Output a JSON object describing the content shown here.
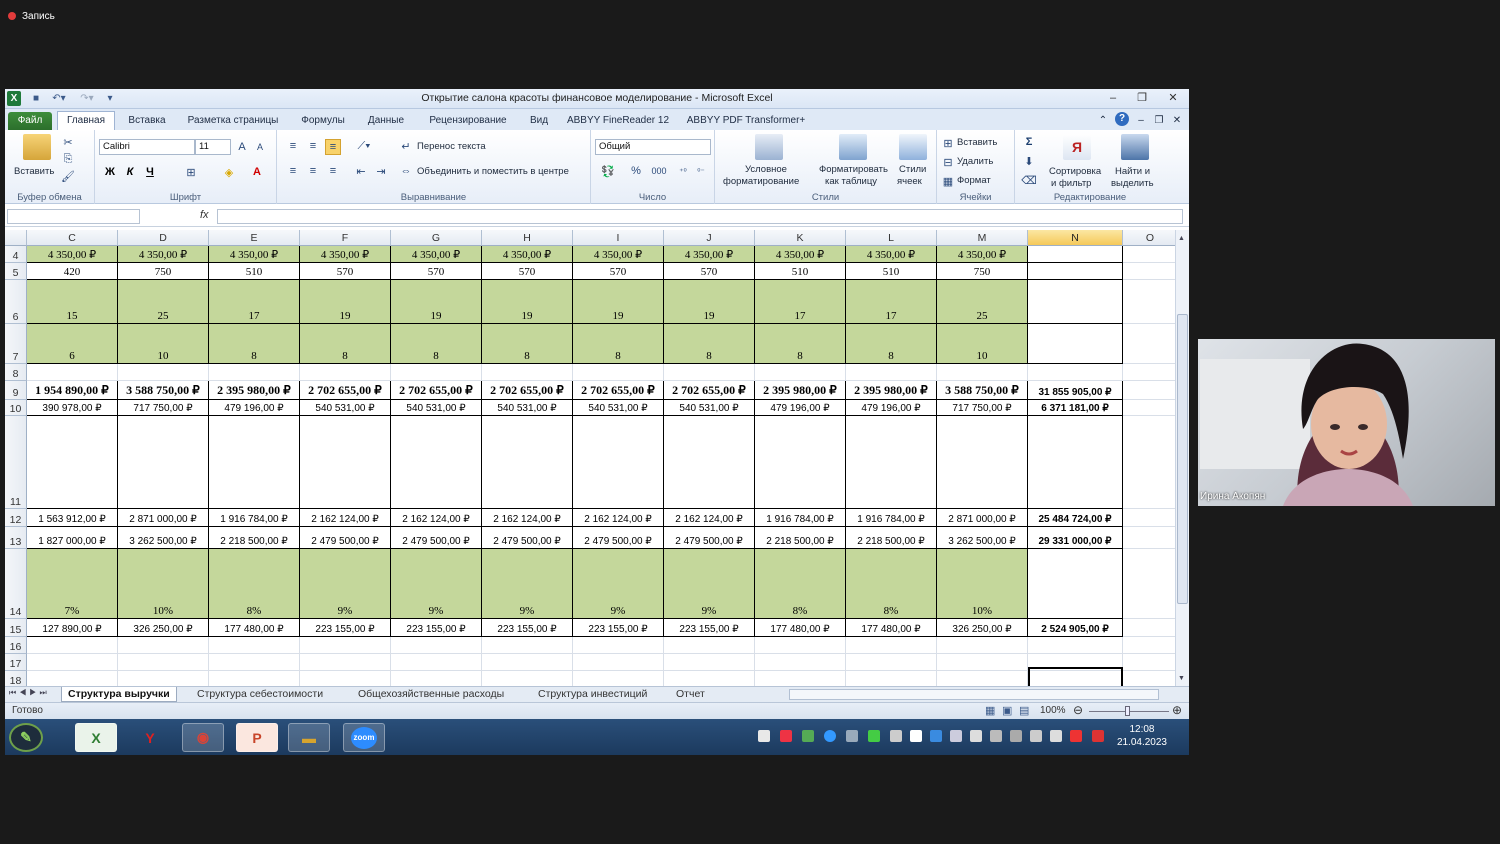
{
  "recording": {
    "label": "Запись"
  },
  "window": {
    "title": "Открытие салона красоты финансовое моделирование - Microsoft Excel"
  },
  "tabs": [
    "Файл",
    "Главная",
    "Вставка",
    "Разметка страницы",
    "Формулы",
    "Данные",
    "Рецензирование",
    "Вид",
    "ABBYY FineReader 12",
    "ABBYY PDF Transformer+"
  ],
  "ribbon": {
    "clipboard": {
      "paste": "Вставить",
      "group": "Буфер обмена"
    },
    "font": {
      "name": "Calibri",
      "size": "11",
      "bold": "Ж",
      "italic": "К",
      "underline": "Ч",
      "group": "Шрифт"
    },
    "align": {
      "wrap": "Перенос текста",
      "merge": "Объединить и поместить в центре",
      "group": "Выравнивание"
    },
    "number": {
      "format": "Общий",
      "percent": "%",
      "thousands": "000",
      "group": "Число"
    },
    "styles": {
      "cond1": "Условное",
      "cond2": "форматирование",
      "fmt1": "Форматировать",
      "fmt2": "как таблицу",
      "cell1": "Стили",
      "cell2": "ячеек",
      "group": "Стили"
    },
    "cells": {
      "insert": "Вставить",
      "delete": "Удалить",
      "format": "Формат",
      "group": "Ячейки"
    },
    "edit": {
      "sort1": "Сортировка",
      "sort2": "и фильтр",
      "find1": "Найти и",
      "find2": "выделить",
      "sigma": "Σ",
      "group": "Редактирование"
    }
  },
  "formula": {
    "fx": "fx"
  },
  "columns": [
    "C",
    "D",
    "E",
    "F",
    "G",
    "H",
    "I",
    "J",
    "K",
    "L",
    "M",
    "N",
    "O"
  ],
  "selected_column": "N",
  "rows": [
    {
      "n": "4",
      "h": 17,
      "style": "g",
      "cells": [
        "4 350,00 ₽",
        "4 350,00 ₽",
        "4 350,00 ₽",
        "4 350,00 ₽",
        "4 350,00 ₽",
        "4 350,00 ₽",
        "4 350,00 ₽",
        "4 350,00 ₽",
        "4 350,00 ₽",
        "4 350,00 ₽",
        "4 350,00 ₽"
      ],
      "total": ""
    },
    {
      "n": "5",
      "h": 17,
      "style": "",
      "cells": [
        "420",
        "750",
        "510",
        "570",
        "570",
        "570",
        "570",
        "570",
        "510",
        "510",
        "750"
      ],
      "total": ""
    },
    {
      "n": "6",
      "h": 44,
      "style": "g",
      "cells": [
        "15",
        "25",
        "17",
        "19",
        "19",
        "19",
        "19",
        "19",
        "17",
        "17",
        "25"
      ],
      "total": ""
    },
    {
      "n": "7",
      "h": 40,
      "style": "g",
      "cells": [
        "6",
        "10",
        "8",
        "8",
        "8",
        "8",
        "8",
        "8",
        "8",
        "8",
        "10"
      ],
      "total": ""
    },
    {
      "n": "8",
      "h": 17,
      "style": "empty",
      "cells": [
        "",
        "",
        "",
        "",
        "",
        "",
        "",
        "",
        "",
        "",
        ""
      ],
      "total": ""
    },
    {
      "n": "9",
      "h": 19,
      "style": "b",
      "cells": [
        "1 954 890,00 ₽",
        "3 588 750,00 ₽",
        "2 395 980,00 ₽",
        "2 702 655,00 ₽",
        "2 702 655,00 ₽",
        "2 702 655,00 ₽",
        "2 702 655,00 ₽",
        "2 702 655,00 ₽",
        "2 395 980,00 ₽",
        "2 395 980,00 ₽",
        "3 588 750,00 ₽"
      ],
      "total": "31 855 905,00 ₽"
    },
    {
      "n": "10",
      "h": 16,
      "style": "n",
      "cells": [
        "390 978,00 ₽",
        "717 750,00 ₽",
        "479 196,00 ₽",
        "540 531,00 ₽",
        "540 531,00 ₽",
        "540 531,00 ₽",
        "540 531,00 ₽",
        "540 531,00 ₽",
        "479 196,00 ₽",
        "479 196,00 ₽",
        "717 750,00 ₽"
      ],
      "total": "6 371 181,00 ₽"
    },
    {
      "n": "11",
      "h": 93,
      "style": "blank",
      "cells": [
        "",
        "",
        "",
        "",
        "",
        "",
        "",
        "",
        "",
        "",
        ""
      ],
      "total": ""
    },
    {
      "n": "12",
      "h": 18,
      "style": "n",
      "cells": [
        "1 563 912,00 ₽",
        "2 871 000,00 ₽",
        "1 916 784,00 ₽",
        "2 162 124,00 ₽",
        "2 162 124,00 ₽",
        "2 162 124,00 ₽",
        "2 162 124,00 ₽",
        "2 162 124,00 ₽",
        "1 916 784,00 ₽",
        "1 916 784,00 ₽",
        "2 871 000,00 ₽"
      ],
      "total": "25 484 724,00 ₽"
    },
    {
      "n": "13",
      "h": 22,
      "style": "n",
      "cells": [
        "1 827 000,00 ₽",
        "3 262 500,00 ₽",
        "2 218 500,00 ₽",
        "2 479 500,00 ₽",
        "2 479 500,00 ₽",
        "2 479 500,00 ₽",
        "2 479 500,00 ₽",
        "2 479 500,00 ₽",
        "2 218 500,00 ₽",
        "2 218 500,00 ₽",
        "3 262 500,00 ₽"
      ],
      "total": "29 331 000,00 ₽"
    },
    {
      "n": "14",
      "h": 70,
      "style": "g",
      "cells": [
        "7%",
        "10%",
        "8%",
        "9%",
        "9%",
        "9%",
        "9%",
        "9%",
        "8%",
        "8%",
        "10%"
      ],
      "total": ""
    },
    {
      "n": "15",
      "h": 18,
      "style": "n",
      "cells": [
        "127 890,00 ₽",
        "326 250,00 ₽",
        "177 480,00 ₽",
        "223 155,00 ₽",
        "223 155,00 ₽",
        "223 155,00 ₽",
        "223 155,00 ₽",
        "223 155,00 ₽",
        "177 480,00 ₽",
        "177 480,00 ₽",
        "326 250,00 ₽"
      ],
      "total": "2 524 905,00 ₽"
    },
    {
      "n": "16",
      "h": 17,
      "style": "empty",
      "cells": [
        "",
        "",
        "",
        "",
        "",
        "",
        "",
        "",
        "",
        "",
        ""
      ],
      "total": ""
    },
    {
      "n": "17",
      "h": 17,
      "style": "empty",
      "cells": [
        "",
        "",
        "",
        "",
        "",
        "",
        "",
        "",
        "",
        "",
        ""
      ],
      "total": ""
    },
    {
      "n": "18",
      "h": 17,
      "style": "empty",
      "cells": [
        "",
        "",
        "",
        "",
        "",
        "",
        "",
        "",
        "",
        "",
        ""
      ],
      "total": ""
    }
  ],
  "sheets": [
    "Структура выручки",
    "Структура себестоимости",
    "Общехозяйственные расходы",
    "Структура инвестиций",
    "Отчет"
  ],
  "active_sheet": "Структура выручки",
  "status": {
    "ready": "Готово",
    "zoom": "100%"
  },
  "taskbar": {
    "time": "12:08",
    "date": "21.04.2023",
    "zoom_label": "zoom"
  },
  "video": {
    "participant": "Ирина Акопян"
  },
  "colors": {
    "green_fill": "#c4d79b",
    "selected_header": "#f5c95a",
    "excel_green": "#2c6f2c"
  }
}
